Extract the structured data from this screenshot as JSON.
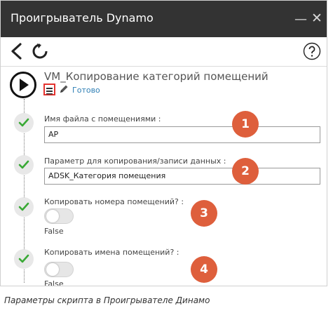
{
  "window": {
    "title": "Проигрыватель Dynamo",
    "minimize_label": "—",
    "close_label": "✕"
  },
  "toolbar": {
    "back_icon": "back-chevron-icon",
    "refresh_icon": "refresh-icon",
    "help_icon": "help-icon"
  },
  "script": {
    "title": "VM_Копирование категорий помещений",
    "status": "Готово",
    "run_icon": "play-icon",
    "edit_icon": "pencil-icon"
  },
  "parameters": [
    {
      "label": "Имя файла с помещениями :",
      "value": "АР",
      "badge": "1"
    },
    {
      "label": "Параметр для копирования/записи данных :",
      "value": "ADSK_Категория помещения",
      "badge": "2"
    },
    {
      "label": "Копировать номера помещений? :",
      "value": "False",
      "badge": "3"
    },
    {
      "label": "Копировать имена помещений? :",
      "value": "False",
      "badge": "4"
    }
  ],
  "caption": "Параметры скрипта в Проигрывателе Динамо",
  "colors": {
    "titlebar": "#333333",
    "badge": "#de5f3c",
    "check": "#39a935",
    "highlight": "#e4332f",
    "status": "#2f7fb5"
  }
}
